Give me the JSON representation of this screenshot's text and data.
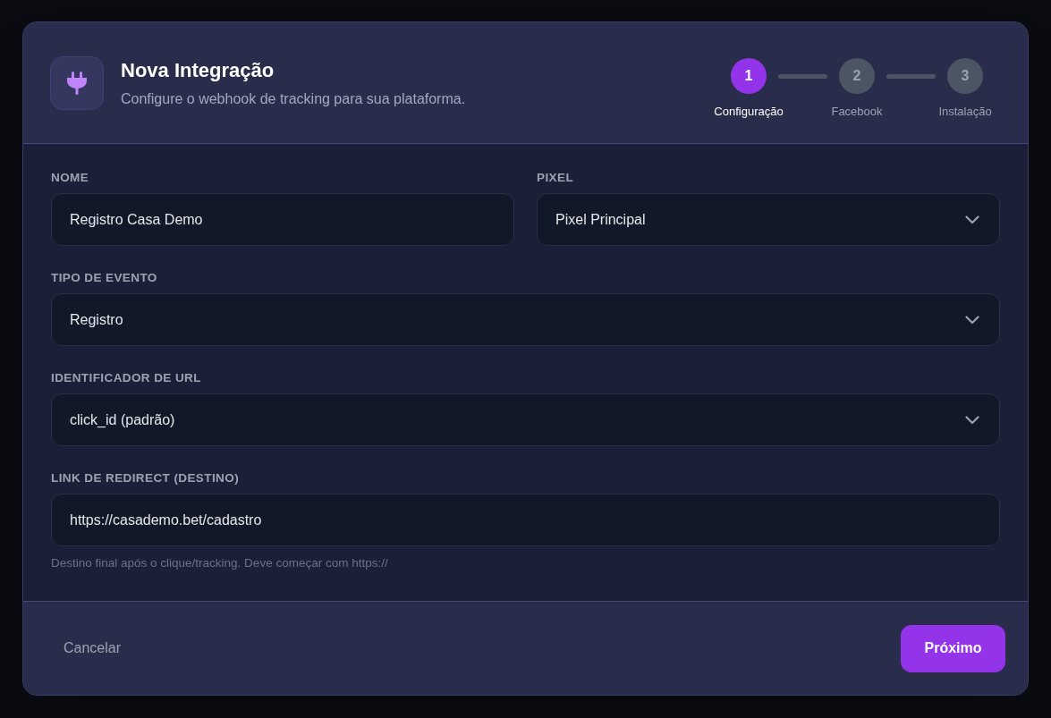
{
  "dialog": {
    "title": "Nova Integração",
    "subtitle": "Configure o webhook de tracking para sua plataforma."
  },
  "steps": [
    {
      "number": "1",
      "label": "Configuração",
      "active": true
    },
    {
      "number": "2",
      "label": "Facebook",
      "active": false
    },
    {
      "number": "3",
      "label": "Instalação",
      "active": false
    }
  ],
  "rows": [
    {
      "fields": [
        {
          "label": "NOME",
          "kind": "text",
          "value": "Registro Casa Demo"
        },
        {
          "label": "PIXEL",
          "kind": "select",
          "value": "Pixel Principal"
        }
      ]
    },
    {
      "fields": [
        {
          "label": "TIPO DE EVENTO",
          "kind": "select",
          "value": "Registro"
        }
      ]
    },
    {
      "fields": [
        {
          "label": "IDENTIFICADOR DE URL",
          "kind": "select",
          "value": "click_id (padrão)"
        }
      ]
    },
    {
      "fields": [
        {
          "label": "LINK DE REDIRECT (DESTINO)",
          "kind": "text",
          "value": "https://casademo.bet/cadastro",
          "hint": "Destino final após o clique/tracking. Deve começar com https://"
        }
      ]
    }
  ],
  "footer": {
    "cancel": "Cancelar",
    "next": "Próximo"
  }
}
